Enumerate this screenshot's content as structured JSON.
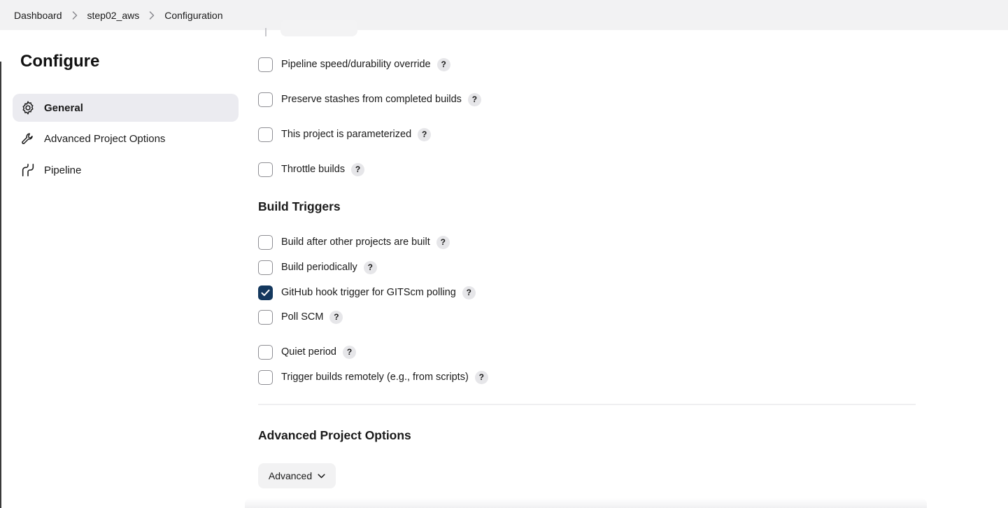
{
  "breadcrumb": [
    "Dashboard",
    "step02_aws",
    "Configuration"
  ],
  "sidebar": {
    "title": "Configure",
    "items": [
      {
        "label": "General",
        "icon": "gear-icon",
        "active": true
      },
      {
        "label": "Advanced Project Options",
        "icon": "wrench-icon",
        "active": false
      },
      {
        "label": "Pipeline",
        "icon": "pipeline-icon",
        "active": false
      }
    ]
  },
  "general_options": [
    {
      "label": "Pipeline speed/durability override",
      "checked": false
    },
    {
      "label": "Preserve stashes from completed builds",
      "checked": false
    },
    {
      "label": "This project is parameterized",
      "checked": false
    },
    {
      "label": "Throttle builds",
      "checked": false
    }
  ],
  "build_triggers": {
    "title": "Build Triggers",
    "options": [
      {
        "label": "Build after other projects are built",
        "checked": false
      },
      {
        "label": "Build periodically",
        "checked": false
      },
      {
        "label": "GitHub hook trigger for GITScm polling",
        "checked": true
      },
      {
        "label": "Poll SCM",
        "checked": false
      },
      {
        "label": "Quiet period",
        "checked": false
      },
      {
        "label": "Trigger builds remotely (e.g., from scripts)",
        "checked": false
      }
    ]
  },
  "advanced_section": {
    "title": "Advanced Project Options",
    "button_label": "Advanced"
  },
  "help_glyph": "?",
  "colors": {
    "checked": "#14385e",
    "active_item": "#ebebf0"
  }
}
